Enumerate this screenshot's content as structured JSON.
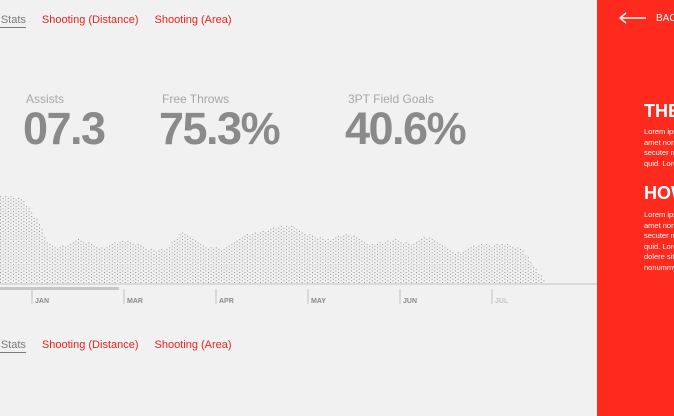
{
  "tabs_top": {
    "items": [
      {
        "label": "er Stats",
        "active": true
      },
      {
        "label": "Shooting (Distance)",
        "active": false
      },
      {
        "label": "Shooting (Area)",
        "active": false
      }
    ]
  },
  "tabs_bottom": {
    "items": [
      {
        "label": "er Stats",
        "active": true
      },
      {
        "label": "Shooting (Distance)",
        "active": false
      },
      {
        "label": "Shooting (Area)",
        "active": false
      }
    ]
  },
  "stats": [
    {
      "label": "Assists",
      "value": "07.3"
    },
    {
      "label": "Free Throws",
      "value": "75.3%"
    },
    {
      "label": "3PT Field Goals",
      "value": "40.6%"
    }
  ],
  "timeline": {
    "months": [
      "JAN",
      "MAR",
      "APR",
      "MAY",
      "JUN",
      "JUL"
    ],
    "profile": [
      0.95,
      0.95,
      0.93,
      0.88,
      0.78,
      0.62,
      0.45,
      0.38,
      0.4,
      0.45,
      0.47,
      0.44,
      0.4,
      0.38,
      0.42,
      0.45,
      0.47,
      0.43,
      0.4,
      0.36,
      0.35,
      0.38,
      0.46,
      0.55,
      0.5,
      0.44,
      0.4,
      0.38,
      0.37,
      0.4,
      0.46,
      0.52,
      0.54,
      0.55,
      0.58,
      0.61,
      0.63,
      0.61,
      0.57,
      0.53,
      0.5,
      0.47,
      0.48,
      0.51,
      0.53,
      0.5,
      0.46,
      0.42,
      0.43,
      0.45,
      0.47,
      0.44,
      0.42,
      0.46,
      0.5,
      0.47,
      0.4,
      0.35,
      0.33,
      0.36,
      0.4,
      0.42,
      0.41,
      0.42,
      0.42,
      0.4,
      0.36,
      0.26,
      0.12,
      0.02
    ],
    "progress": 0.58,
    "colors": {
      "dots": "#8f8f8f",
      "axis": "#c4c4c4",
      "progress": "#c7c7c7"
    }
  },
  "sidebar": {
    "back_label": "BACK",
    "sections": [
      {
        "heading": "THE",
        "lines": [
          "Lorem ips",
          "amet non",
          "secuter m",
          "quid. Lore"
        ]
      },
      {
        "heading": "HOW",
        "lines": [
          "Lorem ips",
          "amet non",
          "secuter m",
          "quid. Lore",
          "dolere sit",
          "nonummy"
        ]
      }
    ],
    "colors": {
      "background": "#ff2a1e",
      "text": "#ffffff"
    }
  }
}
